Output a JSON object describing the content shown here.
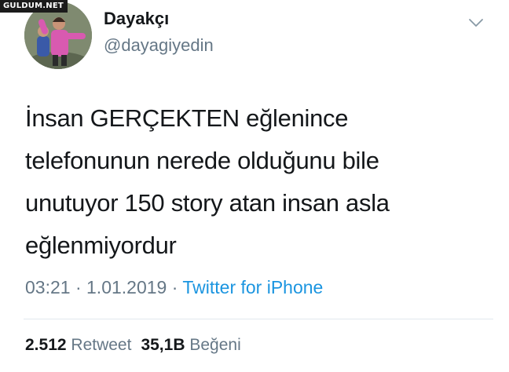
{
  "watermark": "GULDUM.NET",
  "profile": {
    "display_name": "Dayakçı",
    "handle": "@dayagiyedin",
    "avatar_icon": "profile-photo",
    "menu_icon": "chevron-down-icon"
  },
  "tweet": {
    "lines": [
      "İnsan GERÇEKTEN eğlenince",
      "telefonunun nerede olduğunu bile",
      "unutuyor 150 story atan insan asla",
      "eğlenmiyordur"
    ]
  },
  "meta": {
    "time": "03:21",
    "sep1": " · ",
    "date": "1.01.2019",
    "sep2": " · ",
    "source": "Twitter for iPhone"
  },
  "stats": {
    "retweet_count": "2.512",
    "retweet_label": "Retweet",
    "like_count": "35,1B",
    "like_label": "Beğeni"
  },
  "colors": {
    "text": "#14171a",
    "secondary": "#657786",
    "link": "#1b95e0",
    "divider": "#e1e8ed"
  }
}
